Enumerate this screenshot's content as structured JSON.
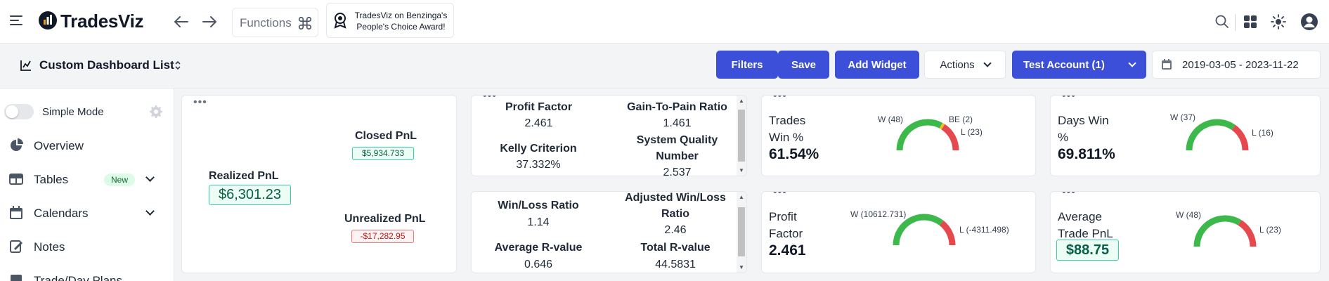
{
  "app": {
    "name": "TradesViz"
  },
  "topbar": {
    "functions_label": "Functions",
    "award_text": "TradesViz on Benzinga's People's Choice Award!",
    "icons": [
      "menu-icon",
      "back-arrow-icon",
      "forward-arrow-icon",
      "command-icon",
      "award-icon",
      "search-icon",
      "grid-icon",
      "sun-icon",
      "user-icon"
    ]
  },
  "subbar": {
    "dashboard_title": "Custom Dashboard List",
    "filters_label": "Filters",
    "save_label": "Save",
    "add_widget_label": "Add Widget",
    "actions_label": "Actions",
    "account_label": "Test Account (1)",
    "date_range": "2019-03-05 - 2023-11-22"
  },
  "sidebar": {
    "simple_mode_label": "Simple Mode",
    "items": [
      {
        "label": "Overview",
        "icon": "pie-chart-icon"
      },
      {
        "label": "Tables",
        "icon": "table-icon",
        "badge": "New"
      },
      {
        "label": "Calendars",
        "icon": "calendar-icon"
      },
      {
        "label": "Notes",
        "icon": "notes-icon"
      },
      {
        "label": "Trade/Day Plans",
        "icon": "plans-icon"
      }
    ]
  },
  "pnl_card": {
    "realized_label": "Realized PnL",
    "realized_value": "$6,301.23",
    "closed_label": "Closed PnL",
    "closed_value": "$5,934.733",
    "unrealized_label": "Unrealized PnL",
    "unrealized_value": "-$17,282.95"
  },
  "stats_card_1": {
    "profit_factor_label": "Profit Factor",
    "profit_factor_value": "2.461",
    "gain_to_pain_label": "Gain-To-Pain Ratio",
    "gain_to_pain_value": "1.461",
    "kelly_label": "Kelly Criterion",
    "kelly_value": "37.332%",
    "sqn_label_1": "System Quality",
    "sqn_label_2": "Number",
    "sqn_value": "2.537"
  },
  "stats_card_2": {
    "win_loss_label": "Win/Loss Ratio",
    "win_loss_value": "1.14",
    "adj_win_loss_label_1": "Adjusted Win/Loss",
    "adj_win_loss_label_2": "Ratio",
    "adj_win_loss_value": "2.46",
    "avg_r_label": "Average R-value",
    "avg_r_value": "0.646",
    "total_r_label": "Total R-value",
    "total_r_value": "44.5831"
  },
  "gauges": {
    "trades_win": {
      "title_1": "Trades",
      "title_2": "Win %",
      "value": "61.54%",
      "w": "W (48)",
      "be": "BE (2)",
      "l": "L (23)",
      "win": 48,
      "breakeven": 2,
      "loss": 23
    },
    "days_win": {
      "title_1": "Days Win",
      "title_2": "%",
      "value": "69.811%",
      "w": "W (37)",
      "l": "L (16)",
      "win": 37,
      "loss": 16
    },
    "profit_factor": {
      "title_1": "Profit",
      "title_2": "Factor",
      "value": "2.461",
      "w": "W (10612.731)",
      "l": "L (-4311.498)",
      "win": 10612.731,
      "loss": 4311.498
    },
    "avg_trade": {
      "title_1": "Average",
      "title_2": "Trade PnL",
      "value": "$88.75",
      "w": "W (48)",
      "l": "L (23)",
      "win": 48,
      "loss": 23
    }
  },
  "colors": {
    "primary": "#3b4fd8",
    "green": "#3cb94a",
    "red": "#e5484d",
    "yellow": "#f0c020"
  }
}
